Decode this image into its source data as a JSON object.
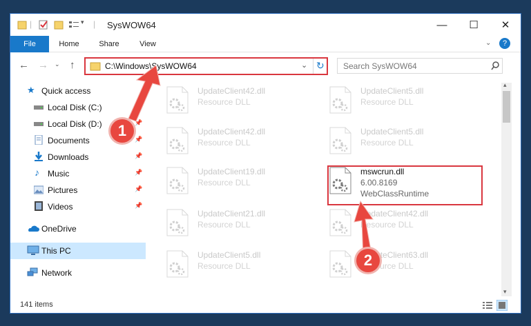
{
  "window": {
    "title": "SysWOW64",
    "controls": {
      "minimize": "—",
      "maximize": "☐",
      "close": "✕"
    }
  },
  "ribbon": {
    "tabs": [
      "File",
      "Home",
      "Share",
      "View"
    ],
    "help": "?"
  },
  "address": {
    "path": "C:\\Windows\\SysWOW64",
    "search_placeholder": "Search SysWOW64"
  },
  "nav": {
    "items": [
      {
        "label": "Quick access",
        "icon": "star-icon",
        "pinned": false
      },
      {
        "label": "Local Disk (C:)",
        "icon": "drive-icon",
        "pinned": true
      },
      {
        "label": "Local Disk (D:)",
        "icon": "drive-icon",
        "pinned": true
      },
      {
        "label": "Documents",
        "icon": "documents-icon",
        "pinned": true
      },
      {
        "label": "Downloads",
        "icon": "downloads-icon",
        "pinned": true
      },
      {
        "label": "Music",
        "icon": "music-icon",
        "pinned": true
      },
      {
        "label": "Pictures",
        "icon": "pictures-icon",
        "pinned": true
      },
      {
        "label": "Videos",
        "icon": "videos-icon",
        "pinned": true
      },
      {
        "label": "OneDrive",
        "icon": "cloud-icon",
        "pinned": false
      },
      {
        "label": "This PC",
        "icon": "computer-icon",
        "pinned": false,
        "selected": true
      },
      {
        "label": "Network",
        "icon": "network-icon",
        "pinned": false
      }
    ]
  },
  "files": [
    {
      "name": "UpdateClient42.dll",
      "desc": "Resource DLL"
    },
    {
      "name": "UpdateClient5.dll",
      "desc": "Resource DLL"
    },
    {
      "name": "UpdateClient42.dll",
      "desc": "Resource DLL"
    },
    {
      "name": "UpdateClient5.dll",
      "desc": "Resource DLL"
    },
    {
      "name": "UpdateClient19.dll",
      "desc": "Resource DLL"
    },
    {
      "name": "mswcrun.dll",
      "desc": "6.00.8169",
      "desc2": "WebClassRuntime",
      "highlight": true
    },
    {
      "name": "UpdateClient21.dll",
      "desc": "Resource DLL"
    },
    {
      "name": "UpdateClient42.dll",
      "desc": "Resource DLL"
    },
    {
      "name": "UpdateClient5.dll",
      "desc": "Resource DLL"
    },
    {
      "name": "UpdateClient63.dll",
      "desc": "Resource DLL"
    }
  ],
  "status": {
    "count": "141 items"
  },
  "callouts": [
    "1",
    "2"
  ],
  "colors": {
    "accent": "#1979ca",
    "highlight": "#d9363e",
    "selected": "#cce8ff"
  }
}
